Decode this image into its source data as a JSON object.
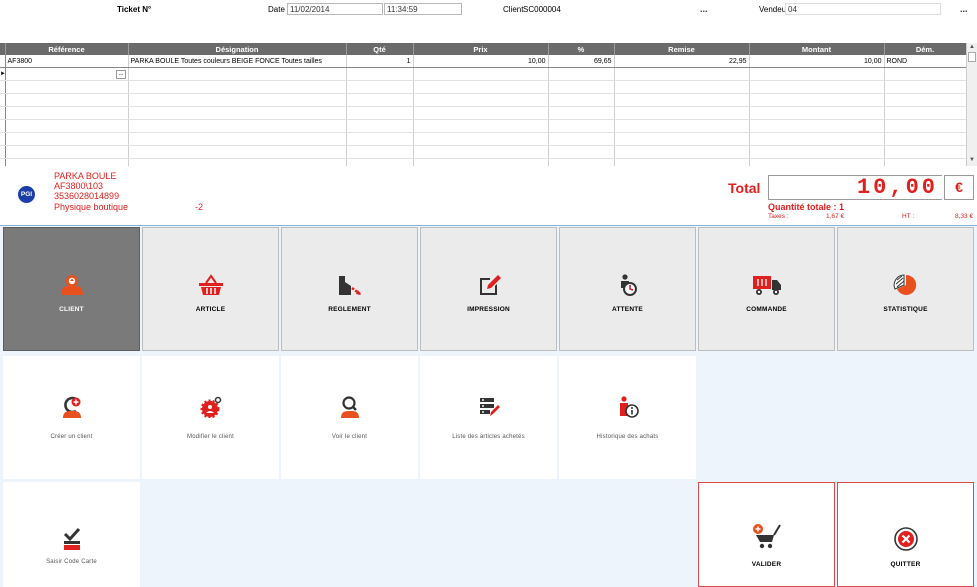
{
  "header": {
    "ticket_label": "Ticket N°",
    "date_label": "Date",
    "date_value": "11/02/2014",
    "time_value": "11:34:59",
    "client_label": "Client",
    "client_value": "SC000004",
    "vendeur_label": "Vendeur",
    "vendeur_value": "04",
    "ellipsis": "..."
  },
  "grid": {
    "columns": [
      "Référence",
      "Désignation",
      "Qté",
      "Prix",
      "%",
      "Remise",
      "Montant",
      "Dém."
    ],
    "rows": [
      {
        "ref": "AF3800",
        "designation": "PARKA BOULE  Toutes couleurs BEIGE FONCE  Toutes tailles",
        "qte": "1",
        "prix": "10,00",
        "pct": "69,65",
        "remise": "22,95",
        "montant": "10,00",
        "dem": "ROND"
      }
    ],
    "row_pointer": "►",
    "ref_button": "..."
  },
  "article_info": {
    "badge": "PGI",
    "name": "PARKA BOULE",
    "code": "AF3800\\103",
    "barcode": "3536028014899",
    "stock_label": "Physique boutique",
    "stock_value": "-2"
  },
  "totals": {
    "total_label": "Total",
    "total_value": "10,00",
    "currency": "€",
    "quantity_label": "Quantité totale : 1",
    "taxes_label": "Taxes :",
    "taxes_value": "1,67 €",
    "ht_label": "HT :",
    "ht_value": "8,33 €"
  },
  "tiles": {
    "client": "CLIENT",
    "article": "ARTICLE",
    "reglement": "REGLEMENT",
    "impression": "IMPRESSION",
    "attente": "ATTENTE",
    "commande": "COMMANDE",
    "statistique": "STATISTIQUE"
  },
  "sub_tiles": {
    "creer": "Créer un client",
    "modifier": "Modifier le client",
    "voir": "Voir le client",
    "liste": "Liste des articles achetés",
    "historique": "Historique des achats",
    "saisir": "Saisir Code Carte"
  },
  "actions": {
    "valider": "VALIDER",
    "quitter": "QUITTER"
  },
  "colors": {
    "accent_red": "#e0201e",
    "tile_orange": "#e8501e",
    "dark_tile": "#7a7a7a",
    "light_tile": "#ebebeb",
    "panel_blue": "#eef4fb"
  }
}
